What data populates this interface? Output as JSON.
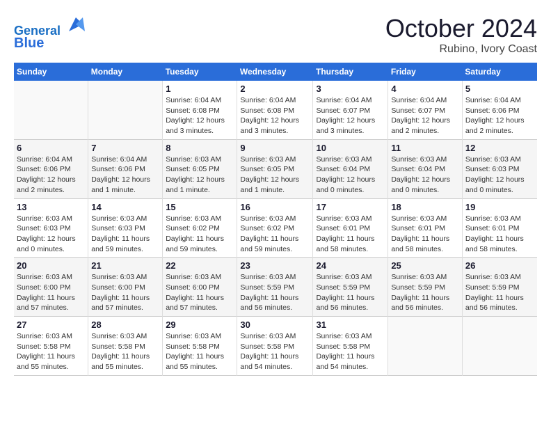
{
  "header": {
    "logo_line1": "General",
    "logo_line2": "Blue",
    "month": "October 2024",
    "location": "Rubino, Ivory Coast"
  },
  "weekdays": [
    "Sunday",
    "Monday",
    "Tuesday",
    "Wednesday",
    "Thursday",
    "Friday",
    "Saturday"
  ],
  "weeks": [
    [
      {
        "day": "",
        "info": ""
      },
      {
        "day": "",
        "info": ""
      },
      {
        "day": "1",
        "info": "Sunrise: 6:04 AM\nSunset: 6:08 PM\nDaylight: 12 hours and 3 minutes."
      },
      {
        "day": "2",
        "info": "Sunrise: 6:04 AM\nSunset: 6:08 PM\nDaylight: 12 hours and 3 minutes."
      },
      {
        "day": "3",
        "info": "Sunrise: 6:04 AM\nSunset: 6:07 PM\nDaylight: 12 hours and 3 minutes."
      },
      {
        "day": "4",
        "info": "Sunrise: 6:04 AM\nSunset: 6:07 PM\nDaylight: 12 hours and 2 minutes."
      },
      {
        "day": "5",
        "info": "Sunrise: 6:04 AM\nSunset: 6:06 PM\nDaylight: 12 hours and 2 minutes."
      }
    ],
    [
      {
        "day": "6",
        "info": "Sunrise: 6:04 AM\nSunset: 6:06 PM\nDaylight: 12 hours and 2 minutes."
      },
      {
        "day": "7",
        "info": "Sunrise: 6:04 AM\nSunset: 6:06 PM\nDaylight: 12 hours and 1 minute."
      },
      {
        "day": "8",
        "info": "Sunrise: 6:03 AM\nSunset: 6:05 PM\nDaylight: 12 hours and 1 minute."
      },
      {
        "day": "9",
        "info": "Sunrise: 6:03 AM\nSunset: 6:05 PM\nDaylight: 12 hours and 1 minute."
      },
      {
        "day": "10",
        "info": "Sunrise: 6:03 AM\nSunset: 6:04 PM\nDaylight: 12 hours and 0 minutes."
      },
      {
        "day": "11",
        "info": "Sunrise: 6:03 AM\nSunset: 6:04 PM\nDaylight: 12 hours and 0 minutes."
      },
      {
        "day": "12",
        "info": "Sunrise: 6:03 AM\nSunset: 6:03 PM\nDaylight: 12 hours and 0 minutes."
      }
    ],
    [
      {
        "day": "13",
        "info": "Sunrise: 6:03 AM\nSunset: 6:03 PM\nDaylight: 12 hours and 0 minutes."
      },
      {
        "day": "14",
        "info": "Sunrise: 6:03 AM\nSunset: 6:03 PM\nDaylight: 11 hours and 59 minutes."
      },
      {
        "day": "15",
        "info": "Sunrise: 6:03 AM\nSunset: 6:02 PM\nDaylight: 11 hours and 59 minutes."
      },
      {
        "day": "16",
        "info": "Sunrise: 6:03 AM\nSunset: 6:02 PM\nDaylight: 11 hours and 59 minutes."
      },
      {
        "day": "17",
        "info": "Sunrise: 6:03 AM\nSunset: 6:01 PM\nDaylight: 11 hours and 58 minutes."
      },
      {
        "day": "18",
        "info": "Sunrise: 6:03 AM\nSunset: 6:01 PM\nDaylight: 11 hours and 58 minutes."
      },
      {
        "day": "19",
        "info": "Sunrise: 6:03 AM\nSunset: 6:01 PM\nDaylight: 11 hours and 58 minutes."
      }
    ],
    [
      {
        "day": "20",
        "info": "Sunrise: 6:03 AM\nSunset: 6:00 PM\nDaylight: 11 hours and 57 minutes."
      },
      {
        "day": "21",
        "info": "Sunrise: 6:03 AM\nSunset: 6:00 PM\nDaylight: 11 hours and 57 minutes."
      },
      {
        "day": "22",
        "info": "Sunrise: 6:03 AM\nSunset: 6:00 PM\nDaylight: 11 hours and 57 minutes."
      },
      {
        "day": "23",
        "info": "Sunrise: 6:03 AM\nSunset: 5:59 PM\nDaylight: 11 hours and 56 minutes."
      },
      {
        "day": "24",
        "info": "Sunrise: 6:03 AM\nSunset: 5:59 PM\nDaylight: 11 hours and 56 minutes."
      },
      {
        "day": "25",
        "info": "Sunrise: 6:03 AM\nSunset: 5:59 PM\nDaylight: 11 hours and 56 minutes."
      },
      {
        "day": "26",
        "info": "Sunrise: 6:03 AM\nSunset: 5:59 PM\nDaylight: 11 hours and 56 minutes."
      }
    ],
    [
      {
        "day": "27",
        "info": "Sunrise: 6:03 AM\nSunset: 5:58 PM\nDaylight: 11 hours and 55 minutes."
      },
      {
        "day": "28",
        "info": "Sunrise: 6:03 AM\nSunset: 5:58 PM\nDaylight: 11 hours and 55 minutes."
      },
      {
        "day": "29",
        "info": "Sunrise: 6:03 AM\nSunset: 5:58 PM\nDaylight: 11 hours and 55 minutes."
      },
      {
        "day": "30",
        "info": "Sunrise: 6:03 AM\nSunset: 5:58 PM\nDaylight: 11 hours and 54 minutes."
      },
      {
        "day": "31",
        "info": "Sunrise: 6:03 AM\nSunset: 5:58 PM\nDaylight: 11 hours and 54 minutes."
      },
      {
        "day": "",
        "info": ""
      },
      {
        "day": "",
        "info": ""
      }
    ]
  ]
}
